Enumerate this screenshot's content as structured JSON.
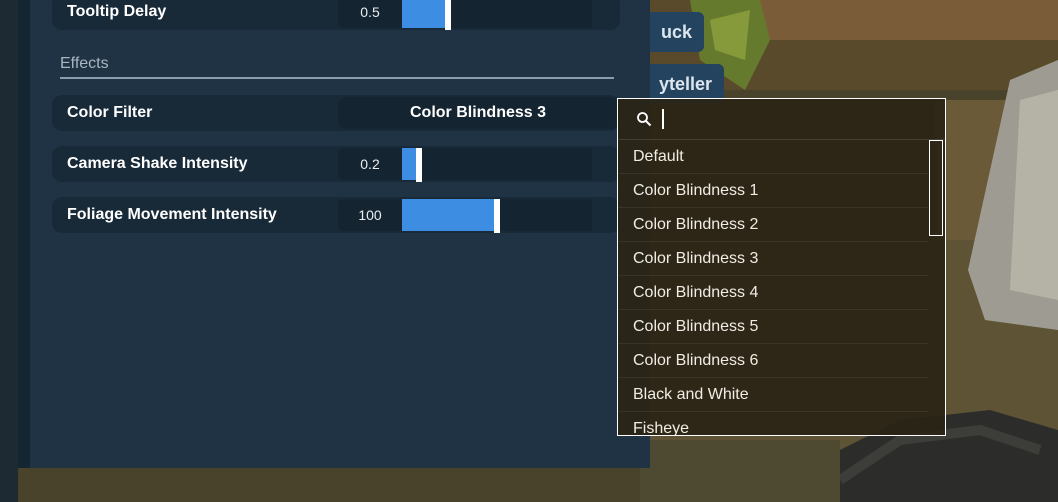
{
  "settings": {
    "tooltip_delay": {
      "label": "Tooltip Delay",
      "value": "0.5",
      "fill_fraction": 0.24
    },
    "section_effects": "Effects",
    "color_filter": {
      "label": "Color Filter",
      "selected": "Color Blindness 3"
    },
    "camera_shake": {
      "label": "Camera Shake Intensity",
      "value": "0.2",
      "fill_fraction": 0.09
    },
    "foliage_movement": {
      "label": "Foliage Movement Intensity",
      "value": "100",
      "fill_fraction": 0.5
    }
  },
  "background_buttons": [
    {
      "label": "uck"
    },
    {
      "label": "yteller"
    }
  ],
  "dropdown": {
    "search_value": "",
    "options": [
      "Default",
      "Color Blindness 1",
      "Color Blindness 2",
      "Color Blindness 3",
      "Color Blindness 4",
      "Color Blindness 5",
      "Color Blindness 6",
      "Black and White",
      "Fisheye"
    ]
  },
  "colors": {
    "panel": "#1f3344",
    "row": "#182a38",
    "slider_fill": "#3d8ee3",
    "dropdown_bg": "#2a2416"
  },
  "icons": {
    "search": "search-icon"
  }
}
